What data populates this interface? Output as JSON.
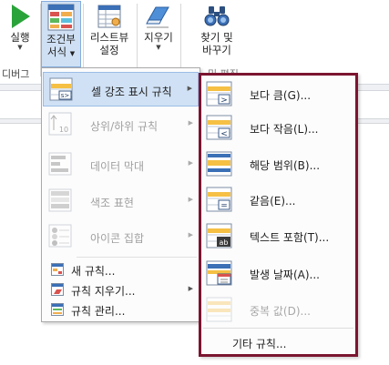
{
  "ribbon": {
    "run": {
      "line1": "실행",
      "line2": "디버그"
    },
    "cond_format": {
      "line1": "조건부",
      "line2": "서식"
    },
    "listview": {
      "line1": "리스트뷰",
      "line2": "설정"
    },
    "erase": {
      "line1": "지우기"
    },
    "find": {
      "line1": "찾기 및",
      "line2": "바꾸기",
      "group": "및 편집"
    }
  },
  "menu": {
    "items": [
      {
        "label": "셀 강조 표시 규칙",
        "icon": "highlight-cells-icon",
        "highlighted": true,
        "enabled": true
      },
      {
        "label": "상위/하위 규칙",
        "icon": "top-bottom-icon",
        "enabled": false
      },
      {
        "label": "데이터 막대",
        "icon": "data-bar-icon",
        "enabled": false
      },
      {
        "label": "색조 표현",
        "icon": "color-scale-icon",
        "enabled": false
      },
      {
        "label": "아이콘 집합",
        "icon": "icon-set-icon",
        "enabled": false
      }
    ],
    "small_items": [
      {
        "label": "새 규칙...",
        "icon": "new-rule-icon"
      },
      {
        "label": "규칙 지우기...",
        "icon": "clear-rules-icon"
      },
      {
        "label": "규칙 관리...",
        "icon": "manage-rules-icon"
      }
    ]
  },
  "submenu": {
    "items": [
      {
        "label": "보다 큼(G)...",
        "icon": "greater-than-icon",
        "enabled": true
      },
      {
        "label": "보다 작음(L)...",
        "icon": "less-than-icon",
        "enabled": true
      },
      {
        "label": "해당 범위(B)...",
        "icon": "between-icon",
        "enabled": true
      },
      {
        "label": "같음(E)...",
        "icon": "equal-to-icon",
        "enabled": true
      },
      {
        "label": "텍스트 포함(T)...",
        "icon": "text-contains-icon",
        "enabled": true
      },
      {
        "label": "발생 날짜(A)...",
        "icon": "date-occurring-icon",
        "enabled": true
      },
      {
        "label": "중복 값(D)...",
        "icon": "duplicate-values-icon",
        "enabled": false
      }
    ],
    "more_rules": "기타 규칙..."
  },
  "colors": {
    "highlight_bg": "#d0e1f5",
    "submenu_border": "#7b1530",
    "disabled_text": "#a0a0a0"
  }
}
